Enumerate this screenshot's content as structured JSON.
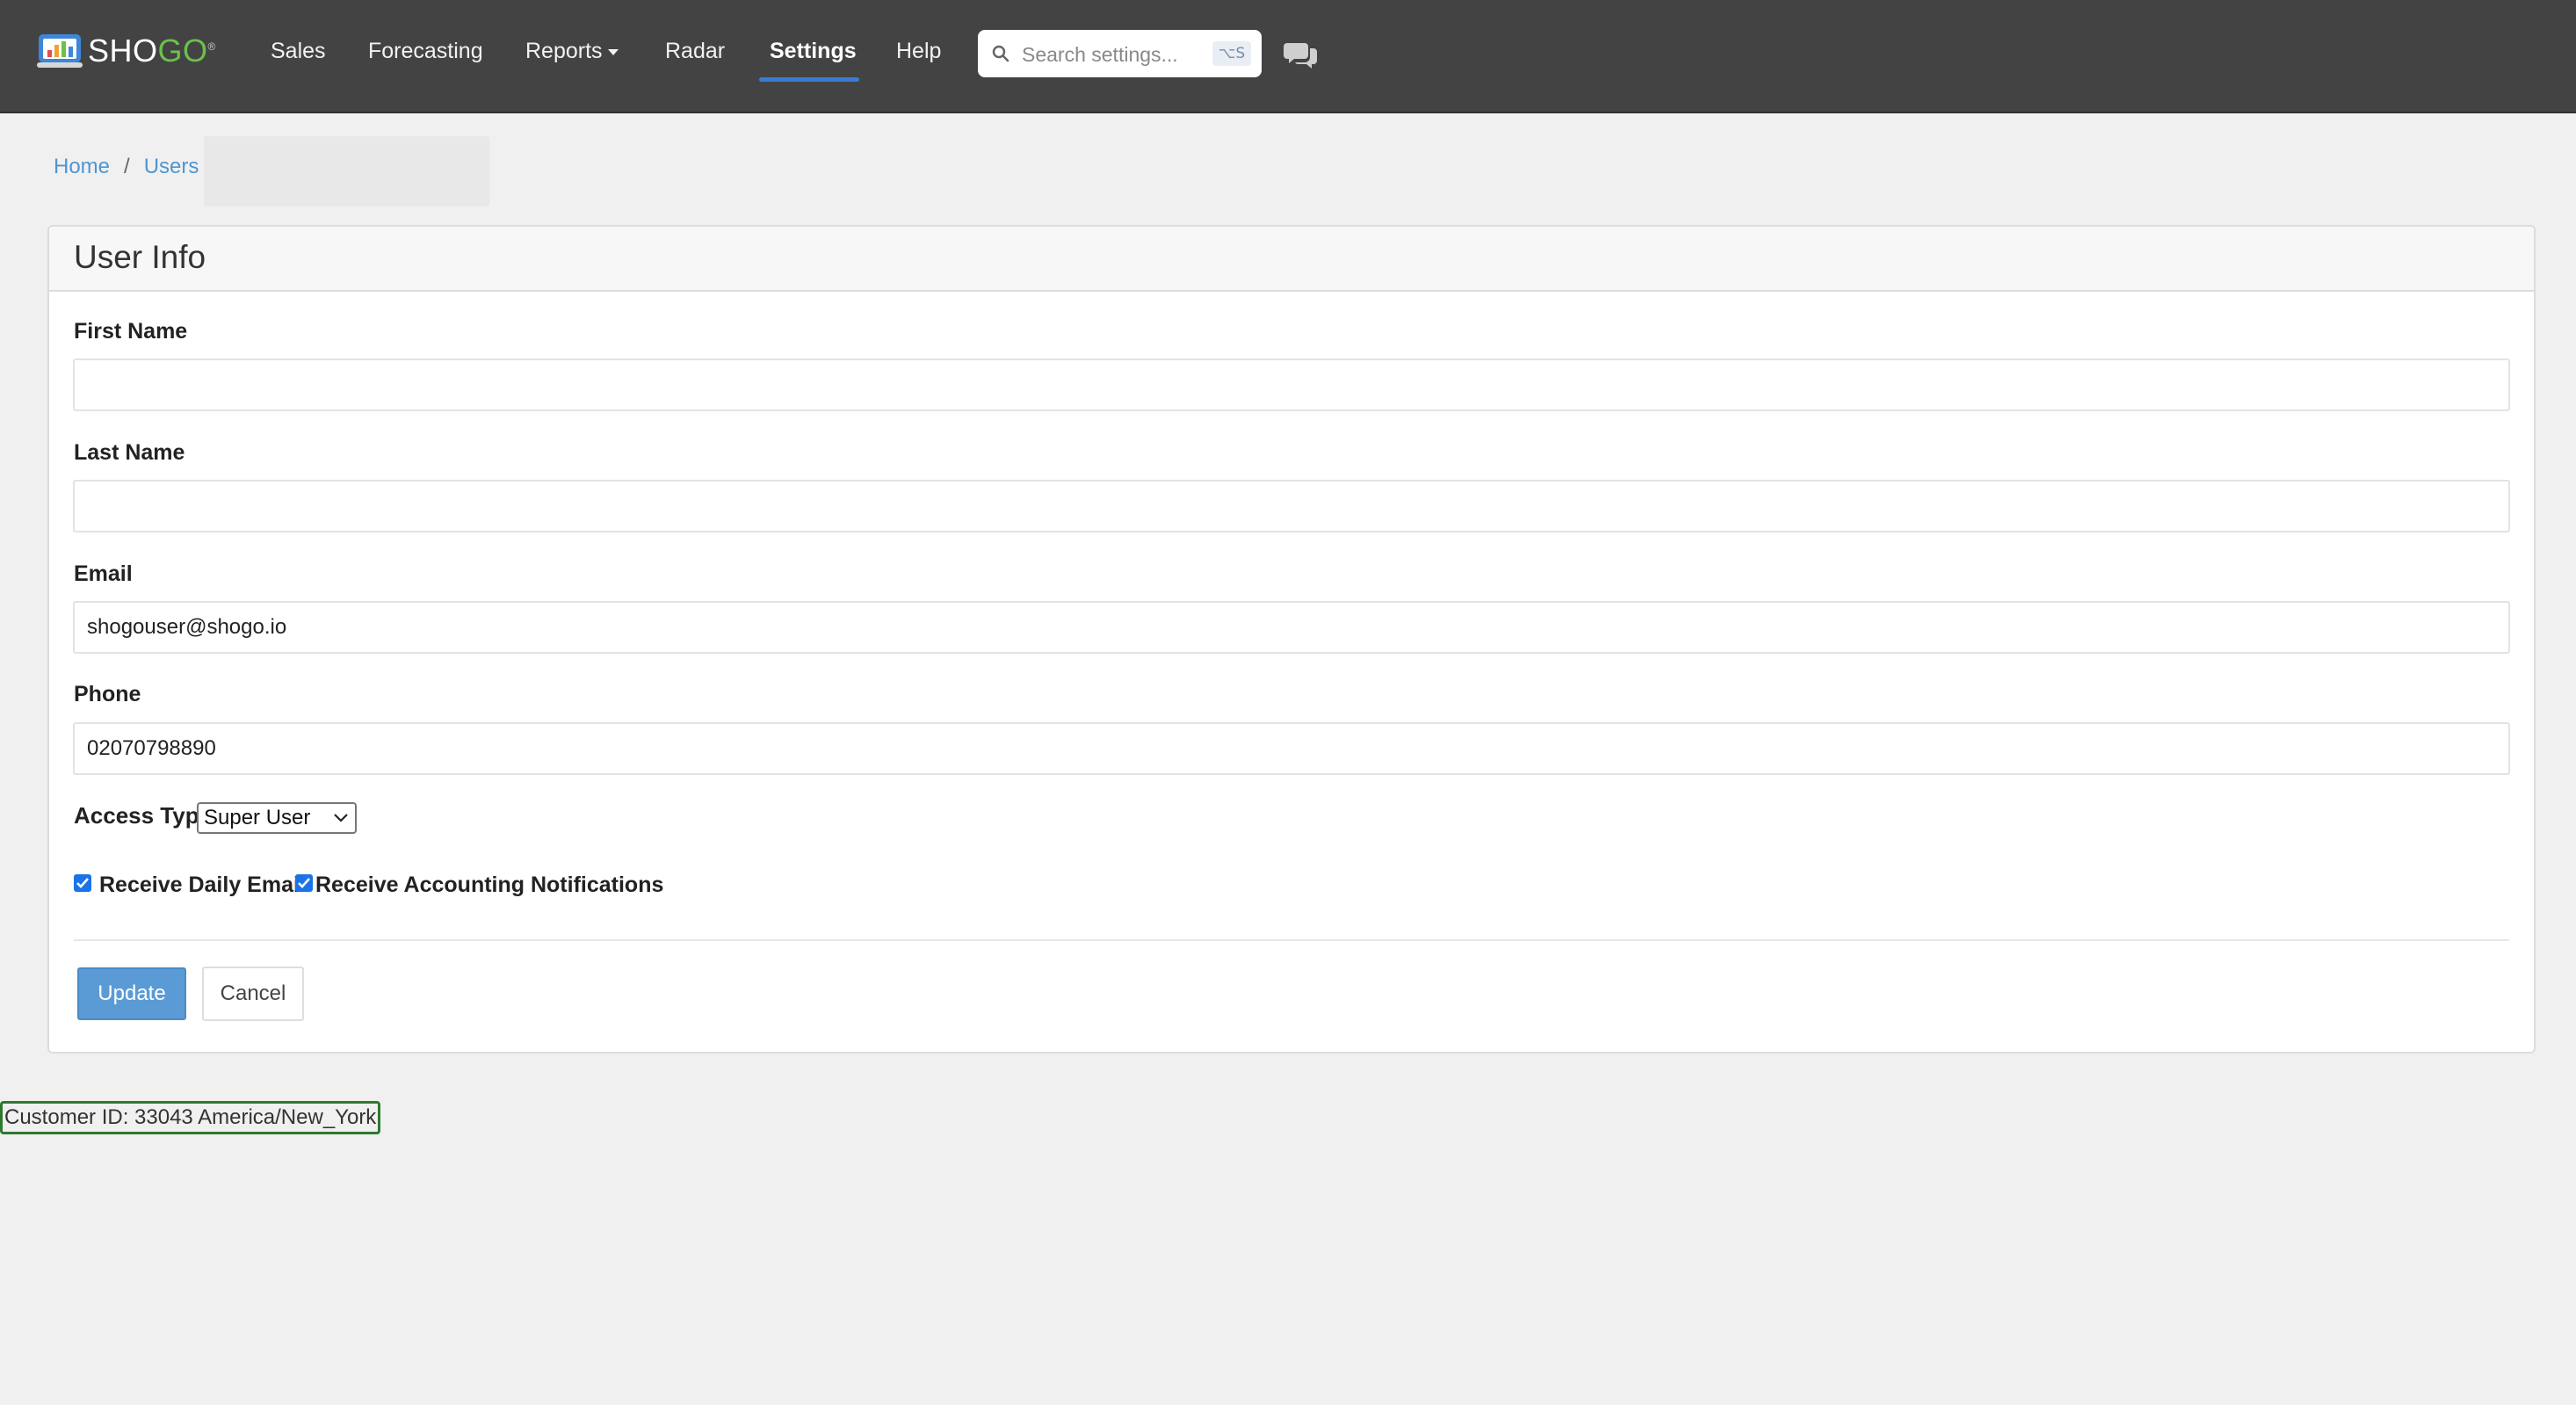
{
  "brand": {
    "name_part1": "SHO",
    "name_part2": "GO",
    "registered": "®",
    "accent_color": "#6cc04a"
  },
  "nav": {
    "items": [
      {
        "label": "Sales"
      },
      {
        "label": "Forecasting"
      },
      {
        "label": "Reports"
      },
      {
        "label": "Radar"
      },
      {
        "label": "Settings",
        "active": true
      },
      {
        "label": "Help"
      }
    ],
    "active_color": "#3a7bd5"
  },
  "search": {
    "placeholder": "Search settings...",
    "shortcut": "⌥S"
  },
  "breadcrumb": {
    "home": "Home",
    "separator": "/",
    "users": "Users"
  },
  "card": {
    "title": "User Info",
    "fields": {
      "first_name": {
        "label": "First Name",
        "value": ""
      },
      "last_name": {
        "label": "Last Name",
        "value": ""
      },
      "email": {
        "label": "Email",
        "value": "shogouser@shogo.io"
      },
      "phone": {
        "label": "Phone",
        "value": "02070798890"
      }
    },
    "access_type": {
      "label": "Access Type",
      "selected": "Super User"
    },
    "checkboxes": {
      "daily_email": {
        "label": "Receive Daily Email",
        "checked": true
      },
      "accounting_notifications": {
        "label": "Receive Accounting Notifications",
        "checked": true
      }
    },
    "buttons": {
      "update": "Update",
      "cancel": "Cancel",
      "update_color": "#5b9bd5"
    }
  },
  "footer": {
    "customer_id": "Customer ID: 33043 America/New_York"
  }
}
